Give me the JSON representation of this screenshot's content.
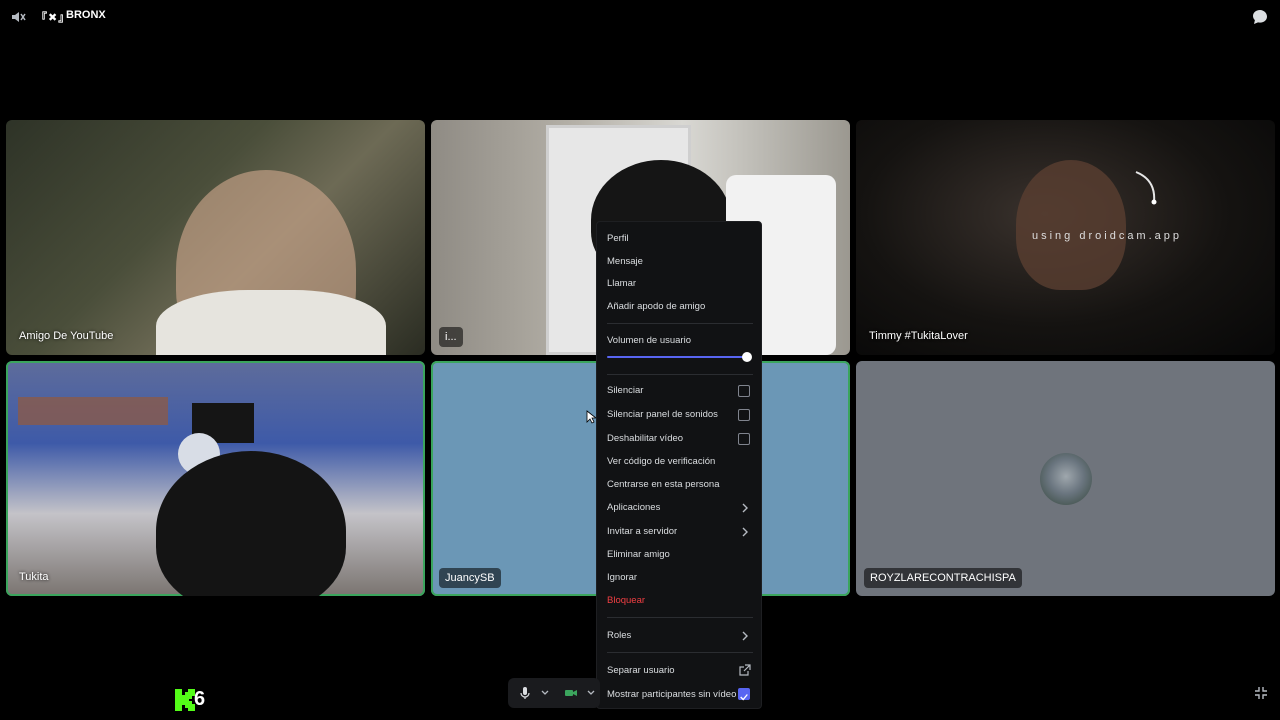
{
  "topbar": {
    "server_tag": "『✖』",
    "channel": "BRONX"
  },
  "tiles": [
    {
      "name": "Amigo De YouTube",
      "speaking": false
    },
    {
      "name": "i...",
      "speaking": false
    },
    {
      "name": "Timmy #TukitaLover",
      "speaking": false,
      "overlay_text": "using droidcam.app"
    },
    {
      "name": "Tukita",
      "speaking": true
    },
    {
      "name": "JuancySB",
      "speaking": true
    },
    {
      "name": "ROYZLARECONTRACHISPA",
      "speaking": false
    }
  ],
  "context_menu": {
    "profile": "Perfil",
    "message": "Mensaje",
    "call": "Llamar",
    "add_nickname": "Añadir apodo de amigo",
    "volume_label": "Volumen de usuario",
    "volume_level": 1.0,
    "mute": "Silenciar",
    "mute_soundboard": "Silenciar panel de sonidos",
    "disable_video": "Deshabilitar vídeo",
    "verify_code": "Ver código de verificación",
    "focus_person": "Centrarse en esta persona",
    "apps": "Aplicaciones",
    "invite": "Invitar a servidor",
    "remove_friend": "Eliminar amigo",
    "ignore": "Ignorar",
    "block": "Bloquear",
    "roles": "Roles",
    "popout": "Separar usuario",
    "show_no_video": "Mostrar participantes sin vídeo",
    "show_no_video_checked": true
  },
  "overlay": {
    "kick_count": "6"
  },
  "colors": {
    "accent": "#5865f2",
    "danger": "#f23f43",
    "speaking": "#3ba55d",
    "kick": "#53fc18"
  }
}
